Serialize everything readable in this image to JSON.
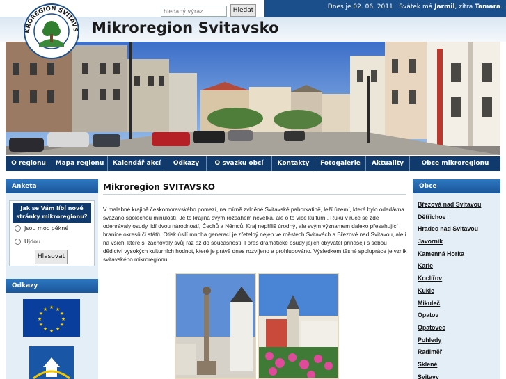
{
  "search": {
    "placeholder": "hledaný výraz",
    "button": "Hledat"
  },
  "topbar": {
    "date_prefix": "Dnes je ",
    "date": "02. 06. 2011",
    "name_day_prefix": "Svátek má ",
    "name_today": "Jarmil",
    "name_tomorrow_prefix": ", zítra ",
    "name_tomorrow": "Tamara",
    "suffix": "."
  },
  "header": {
    "title": "Mikroregion Svitavsko",
    "logo_text": "MIKROREGION SVITAVSKO"
  },
  "nav": {
    "items": [
      {
        "label": "O regionu"
      },
      {
        "label": "Mapa regionu"
      },
      {
        "label": "Kalendář akcí"
      },
      {
        "label": "Odkazy"
      },
      {
        "label": "O svazku obcí"
      },
      {
        "label": "Kontakty"
      },
      {
        "label": "Fotogalerie"
      },
      {
        "label": "Aktuality"
      },
      {
        "label": "Obce mikroregionu"
      }
    ]
  },
  "poll": {
    "heading": "Anketa",
    "question": "Jak se Vám líbí nové stránky mikroregionu?",
    "options": [
      "Jsou moc pěkné",
      "Ujdou"
    ],
    "vote_button": "Hlasovat"
  },
  "links": {
    "heading": "Odkazy"
  },
  "main": {
    "title": "Mikroregion SVITAVSKO",
    "intro": "V malebné krajině českomoravského pomezí, na mírně zvlněné Svitavské pahorkatině, leží území, které bylo odedávna svázáno společnou minulostí. Je to krajina svým rozsahem nevelká, ale o to více kulturní. Ruku v ruce se zde odehrávaly osudy lidí dvou národností, Čechů a Němců. Kraj nepříliš úrodný, ale svým významem daleko přesahující hranice okresů či států. Otisk úsilí mnoha generací je zřetelný nejen ve městech Svitavách a Březové nad Svitavou, ale i na vsích, které si zachovaly svůj ráz až do současnosti. I přes dramatické osudy jejich obyvatel přinášejí s sebou dědictví vysokých kulturních hodnot, které je právě dnes rozvíjeno a prohlubováno. Výsledkem těsné spolupráce je vznik svitavského mikroregionu."
  },
  "obce": {
    "heading": "Obce",
    "items": [
      "Březová nad Svitavou",
      "Dětřichov",
      "Hradec nad Svitavou",
      "Javorník",
      "Kamenná Horka",
      "Karle",
      "Koclířov",
      "Kukle",
      "Mikuleč",
      "Opatov",
      "Opatovec",
      "Pohledy",
      "Radiměř",
      "Sklené",
      "Svitavy"
    ]
  },
  "colors": {
    "nav": "#0f3a6b",
    "box_header": "#1a5599",
    "sidebar": "#e4eef7",
    "topbar": "#1a4f8b"
  }
}
